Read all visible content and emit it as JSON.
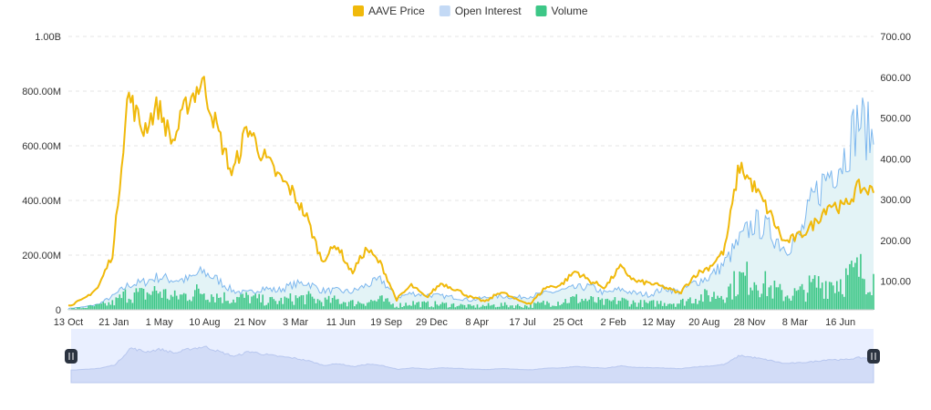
{
  "chart_data": {
    "type": "line",
    "legend": {
      "position": "top-center"
    },
    "series": [
      {
        "name": "AAVE Price",
        "axis": "right",
        "color": "#f0b90b",
        "style": "line",
        "values": [
          40,
          55,
          85,
          170,
          560,
          470,
          530,
          440,
          540,
          590,
          470,
          360,
          480,
          410,
          360,
          320,
          255,
          150,
          190,
          120,
          180,
          140,
          55,
          90,
          60,
          95,
          80,
          60,
          50,
          75,
          55,
          45,
          85,
          90,
          125,
          100,
          85,
          135,
          100,
          95,
          85,
          70,
          115,
          135,
          175,
          385,
          330,
          270,
          195,
          210,
          240,
          290,
          280,
          330,
          320
        ]
      },
      {
        "name": "Open Interest",
        "axis": "left",
        "color": "#7db7ee",
        "style": "area",
        "values": [
          5,
          10,
          20,
          50,
          90,
          100,
          120,
          110,
          110,
          140,
          110,
          70,
          60,
          80,
          70,
          90,
          100,
          70,
          70,
          65,
          90,
          110,
          45,
          60,
          55,
          50,
          45,
          35,
          45,
          50,
          45,
          50,
          60,
          70,
          80,
          85,
          60,
          75,
          60,
          55,
          80,
          65,
          100,
          120,
          170,
          250,
          320,
          290,
          230,
          260,
          410,
          500,
          560,
          700,
          620
        ]
      },
      {
        "name": "Volume",
        "axis": "left",
        "color": "#3dc787",
        "style": "bars",
        "values": [
          3,
          8,
          15,
          25,
          60,
          55,
          70,
          45,
          55,
          70,
          50,
          40,
          45,
          35,
          30,
          40,
          45,
          30,
          35,
          25,
          30,
          35,
          15,
          25,
          20,
          20,
          18,
          12,
          15,
          18,
          15,
          15,
          25,
          30,
          40,
          35,
          25,
          35,
          25,
          22,
          28,
          25,
          45,
          50,
          60,
          110,
          120,
          80,
          55,
          60,
          90,
          100,
          110,
          140,
          120
        ]
      }
    ],
    "x_ticks": [
      "13 Oct",
      "21 Jan",
      "1 May",
      "10 Aug",
      "21 Nov",
      "3 Mar",
      "11 Jun",
      "19 Sep",
      "29 Dec",
      "8 Apr",
      "17 Jul",
      "25 Oct",
      "2 Feb",
      "12 May",
      "20 Aug",
      "28 Nov",
      "8 Mar",
      "16 Jun"
    ],
    "y_left_ticks": [
      "0",
      "200.00M",
      "400.00M",
      "600.00M",
      "800.00M",
      "1.00B"
    ],
    "y_left_range_millions": [
      0,
      1000
    ],
    "y_right_ticks": [
      "100.00",
      "200.00",
      "300.00",
      "400.00",
      "500.00",
      "600.00",
      "700.00"
    ],
    "y_right_range": [
      30,
      700
    ],
    "grid": true,
    "navigator": {
      "visible": true
    }
  }
}
